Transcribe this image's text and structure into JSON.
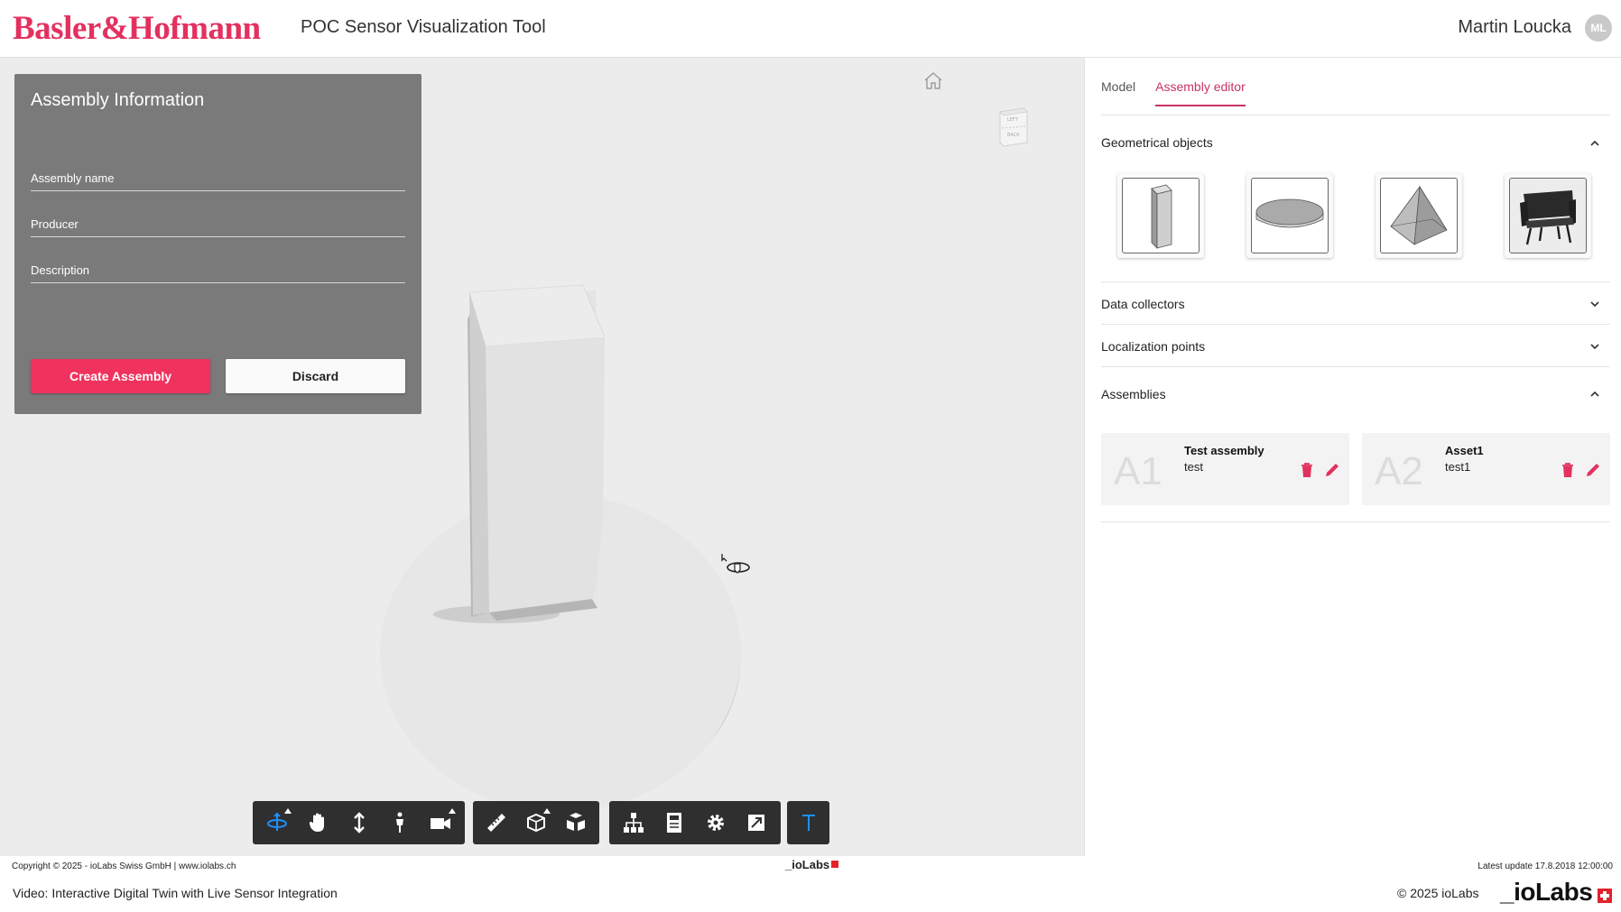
{
  "header": {
    "logo": "Basler&Hofmann",
    "app_title": "POC Sensor Visualization Tool",
    "user_name": "Martin Loucka",
    "avatar_initials": "ML"
  },
  "assembly_form": {
    "title": "Assembly Information",
    "fields": {
      "name_label": "Assembly name",
      "producer_label": "Producer",
      "description_label": "Description"
    },
    "create_label": "Create Assembly",
    "discard_label": "Discard"
  },
  "toolbar": {
    "groups": [
      [
        "orbit-icon",
        "pan-hand-icon",
        "dolly-arrows-icon",
        "walk-person-icon",
        "camera-icon"
      ],
      [
        "measure-ruler-icon",
        "section-box-icon",
        "explode-cubes-icon"
      ],
      [
        "model-tree-icon",
        "properties-icon",
        "settings-gear-icon",
        "fullscreen-icon"
      ],
      [
        "text-t-icon"
      ]
    ],
    "active_tool": "orbit-icon",
    "active_color": "#1e90ff"
  },
  "right_panel": {
    "tabs": [
      {
        "label": "Model",
        "active": false
      },
      {
        "label": "Assembly editor",
        "active": true
      }
    ],
    "sections": {
      "geometrical": "Geometrical objects",
      "data_collectors": "Data collectors",
      "localization": "Localization points",
      "assemblies": "Assemblies"
    },
    "geometry_objects": [
      "box-shape-icon",
      "cylinder-disc-icon",
      "pyramid-shape-icon",
      "chair-shape-icon"
    ],
    "assemblies": [
      {
        "code": "A1",
        "name": "Test assembly",
        "description": "test"
      },
      {
        "code": "A2",
        "name": "Asset1",
        "description": "test1"
      }
    ]
  },
  "footer": {
    "copyright": "Copyright © 2025 - ioLabs Swiss GmbH | www.iolabs.ch",
    "iolabs_small": "_ioLabs",
    "latest_update": "Latest update 17.8.2018 12:00:00",
    "video_caption": "Video: Interactive Digital Twin with Live Sensor Integration",
    "copy_iolabs": "© 2025 ioLabs",
    "iolabs_brand": "_ioLabs"
  },
  "colors": {
    "brand": "#e3315f",
    "accent": "#c8326a",
    "primary_button": "#f0325f",
    "panel_gray": "#7a7a7a",
    "viewport_bg": "#ececec"
  }
}
